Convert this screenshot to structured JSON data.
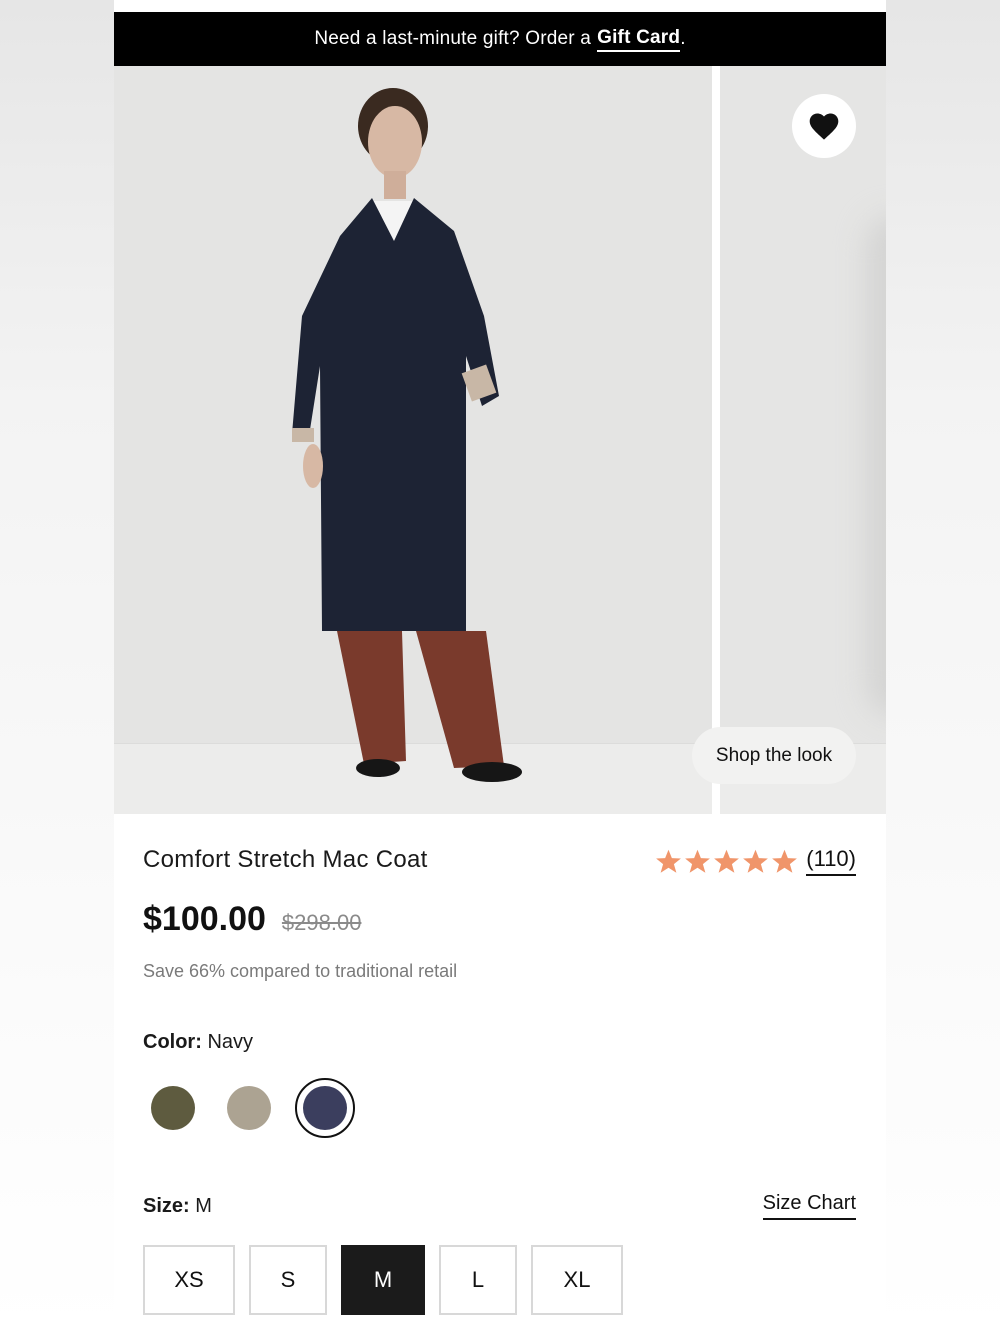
{
  "promo": {
    "text": "Need a last-minute gift? Order a",
    "link": "Gift Card",
    "suffix": "."
  },
  "gallery": {
    "shop_the_look": "Shop the look",
    "favorite_icon": "heart-icon"
  },
  "product": {
    "name": "Comfort Stretch Mac Coat",
    "rating": {
      "stars": 5,
      "count": "(110)",
      "star_color": "#f0956a"
    },
    "price": "$100.00",
    "original_price": "$298.00",
    "savings": "Save 66% compared to traditional retail"
  },
  "color": {
    "label": "Color:",
    "selected": "Navy",
    "swatches": [
      {
        "name": "olive",
        "hex": "#5e5b3f"
      },
      {
        "name": "taupe",
        "hex": "#aca392"
      },
      {
        "name": "navy",
        "hex": "#3b3e5e",
        "selected": true
      }
    ]
  },
  "size": {
    "label": "Size:",
    "selected": "M",
    "chart_link": "Size Chart",
    "options": [
      "XS",
      "S",
      "M",
      "L",
      "XL"
    ]
  }
}
